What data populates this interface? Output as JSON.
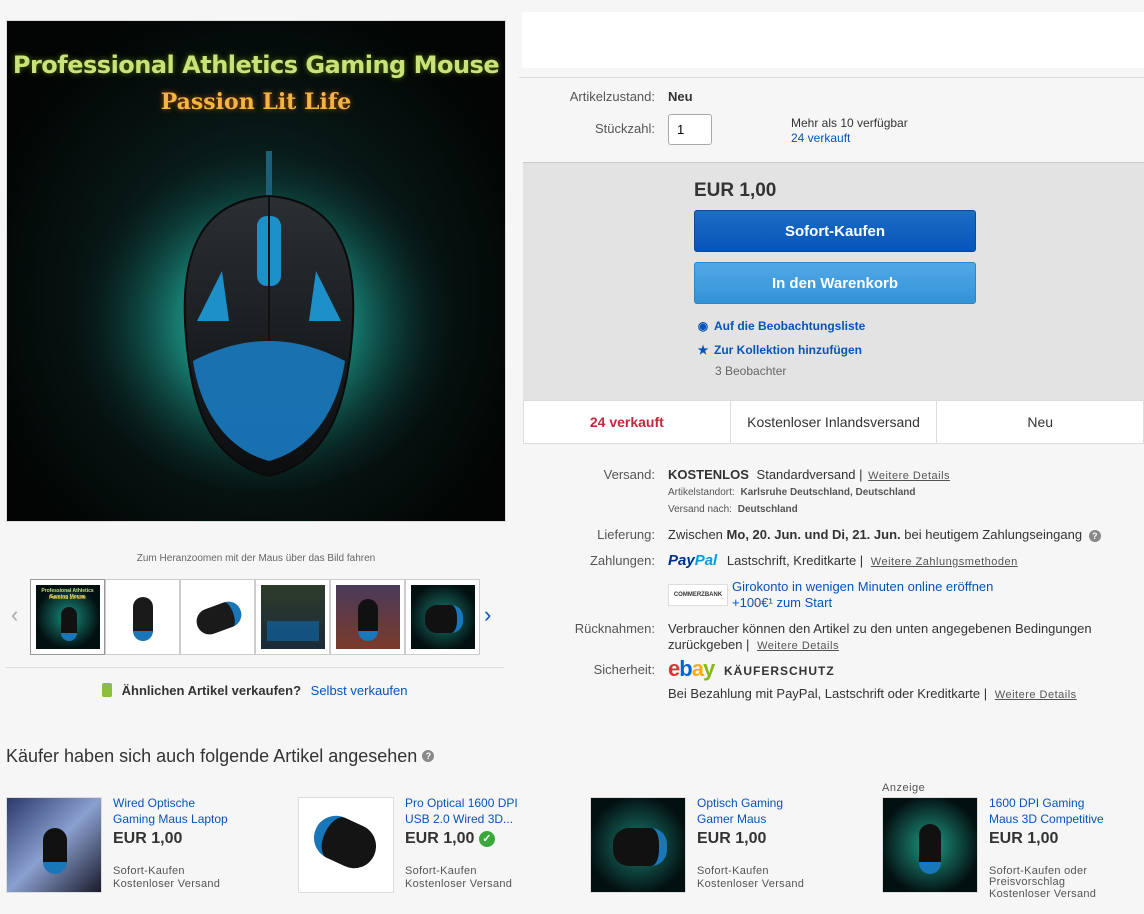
{
  "gallery": {
    "image_title": "Professional  Athletics Gaming Mouse",
    "image_subtitle": "Passion Lit Life",
    "zoom_hint": "Zum Heranzoomen mit der Maus über das Bild fahren",
    "thumbnail_count": 6,
    "thumb1_title": "Professional Athletics Gaming Mouse",
    "thumb1_sub": "Passion Lit Life"
  },
  "sell": {
    "question": "Ähnlichen Artikel verkaufen?",
    "link": "Selbst verkaufen"
  },
  "details": {
    "condition_label": "Artikelzustand:",
    "condition_value": "Neu",
    "qty_label": "Stückzahl:",
    "qty_value": "1",
    "availability": "Mehr als 10 verfügbar",
    "sold_link": "24 verkauft"
  },
  "buybox": {
    "price": "EUR 1,00",
    "buy_now": "Sofort-Kaufen",
    "add_to_cart": "In den Warenkorb",
    "watch": "Auf die Beobachtungsliste",
    "collection": "Zur Kollektion hinzufügen",
    "watchers": "3 Beobachter"
  },
  "stats": {
    "sold": "24 verkauft",
    "shipping": "Kostenloser Inlandsversand",
    "condition": "Neu"
  },
  "shipping": {
    "label": "Versand:",
    "free": "KOSTENLOS",
    "method": "Standardversand |",
    "more": "Weitere Details",
    "location_label": "Artikelstandort:",
    "location": "Karlsruhe Deutschland, Deutschland",
    "to_label": "Versand nach:",
    "to": "Deutschland"
  },
  "delivery": {
    "label": "Lieferung:",
    "between": "Zwischen",
    "dates": "Mo, 20. Jun. und Di, 21. Jun.",
    "suffix": "bei heutigem Zahlungseingang"
  },
  "payments": {
    "label": "Zahlungen:",
    "paypal_a": "Pay",
    "paypal_b": "Pal",
    "methods": "Lastschrift,  Kreditkarte  |",
    "more": "Weitere Zahlungsmethoden",
    "bank": "COMMERZBANK",
    "promo_line1": "Girokonto in wenigen Minuten online eröffnen",
    "promo_line2": "+100€¹ zum Start"
  },
  "returns": {
    "label": "Rücknahmen:",
    "text_line1": "Verbraucher können den Artikel zu den unten angegebenen Bedingungen",
    "text_line2": "zurückgeben |",
    "more": "Weitere Details"
  },
  "security": {
    "label": "Sicherheit:",
    "ebay_e": "e",
    "ebay_b": "b",
    "ebay_a": "a",
    "ebay_y": "y",
    "badge": "KÄUFERSCHUTZ",
    "text": "Bei Bezahlung mit PayPal, Lastschrift oder Kreditkarte |",
    "more": "Weitere Details"
  },
  "recommendations": {
    "heading": "Käufer haben sich auch folgende Artikel angesehen",
    "ad_label": "Anzeige",
    "items": [
      {
        "title_1": "Wired Optische",
        "title_2": "Gaming Maus Laptop",
        "price": "EUR 1,00",
        "meta_1": "Sofort-Kaufen",
        "meta_2": "Kostenloser Versand"
      },
      {
        "title_1": "Pro Optical 1600 DPI",
        "title_2": "USB 2.0 Wired 3D...",
        "price": "EUR 1,00",
        "meta_1": "Sofort-Kaufen",
        "meta_2": "Kostenloser Versand"
      },
      {
        "title_1": "Optisch Gaming",
        "title_2": "Gamer Maus",
        "price": "EUR 1,00",
        "meta_1": "Sofort-Kaufen",
        "meta_2": "Kostenloser Versand"
      },
      {
        "title_1": "1600 DPI Gaming",
        "title_2": "Maus 3D Competitive",
        "price": "EUR 1,00",
        "meta_1": "Sofort-Kaufen oder",
        "meta_2": "Preisvorschlag",
        "meta_3": "Kostenloser Versand"
      }
    ]
  },
  "colors": {
    "link": "#0654ba",
    "buy_button": "#0654ba",
    "cart_button": "#3393d6",
    "sold_red": "#c7253e"
  }
}
